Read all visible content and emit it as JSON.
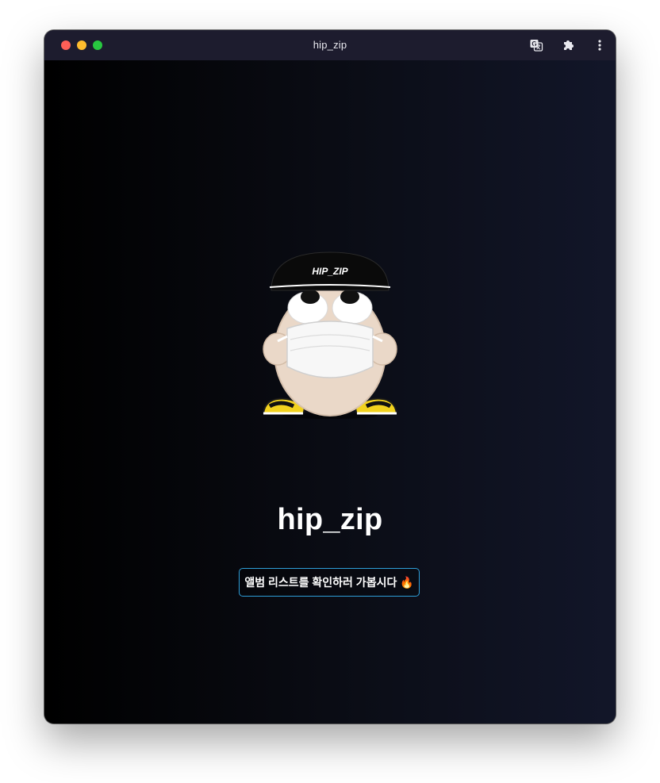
{
  "window": {
    "title": "hip_zip"
  },
  "toolbar": {
    "icons": [
      "translate-icon",
      "extensions-icon",
      "more-menu-icon"
    ]
  },
  "main": {
    "mascot": {
      "hat_text": "HIP_ZIP"
    },
    "heading": "hip_zip",
    "cta_label": "앨범 리스트를 확인하러 가봅시다 🔥"
  },
  "colors": {
    "titlebar": "#1d1c2e",
    "background_left": "#000000",
    "background_right": "#121629",
    "cta_border": "#2e9fd9",
    "traffic_red": "#fe5f57",
    "traffic_yellow": "#febc2e",
    "traffic_green": "#28c840"
  }
}
